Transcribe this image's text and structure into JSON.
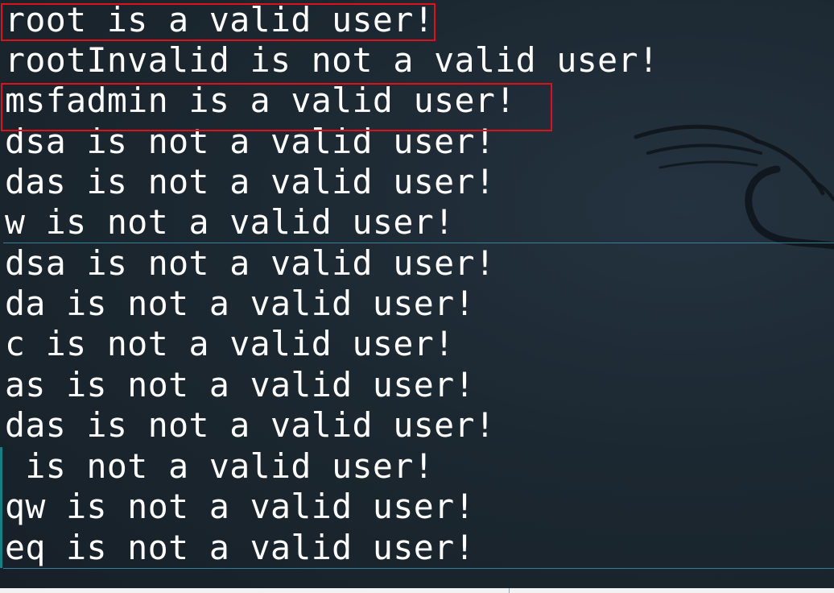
{
  "terminal": {
    "lines": [
      "root is a valid user!",
      "rootInvalid is not a valid user!",
      "msfadmin is a valid user!",
      "dsa is not a valid user!",
      "das is not a valid user!",
      "w is not a valid user!",
      "dsa is not a valid user!",
      "da is not a valid user!",
      "c is not a valid user!",
      "as is not a valid user!",
      "das is not a valid user!",
      " is not a valid user!",
      "qw is not a valid user!",
      "eq is not a valid user!"
    ],
    "highlighted_lines": [
      "root is a valid user!",
      "msfadmin is a valid user!"
    ],
    "highlight_color": "#e0101a",
    "text_color": "#ffffff"
  },
  "wallpaper": {
    "logo_icon": "kali-dragon-icon"
  }
}
